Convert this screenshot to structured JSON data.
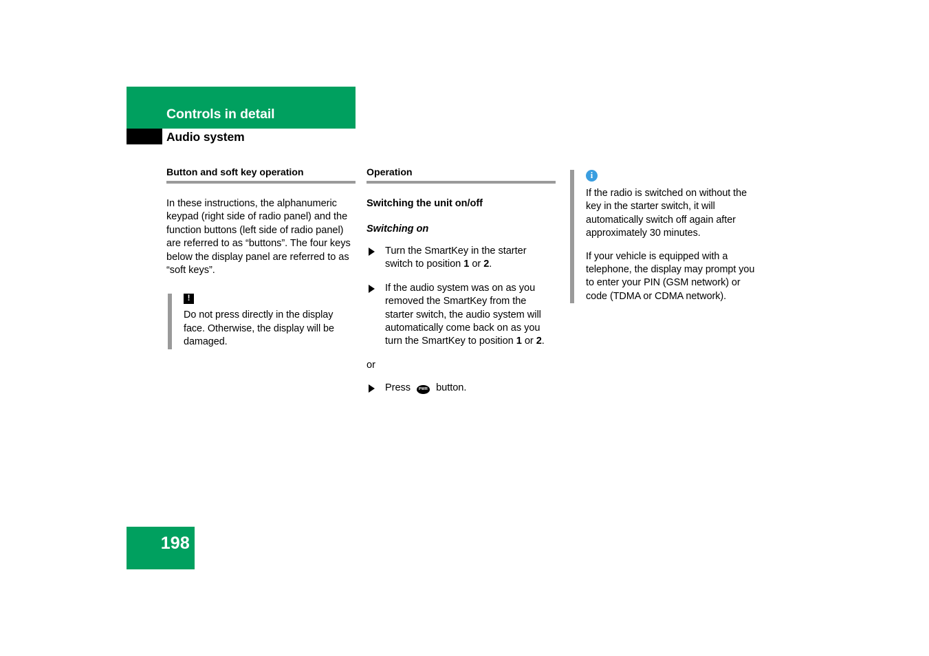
{
  "header": {
    "chapter": "Controls in detail",
    "section": "Audio system",
    "banner_color": "#00A05F"
  },
  "columns": {
    "left": {
      "heading": "Button and soft key operation",
      "paragraph": "In these instructions, the alphanumeric keypad (right side of radio panel) and the function buttons (left side of radio panel) are referred to as “buttons”. The four keys below the display panel are referred to as “soft keys”.",
      "warning": {
        "icon": "warning-exclamation-icon",
        "icon_glyph": "!",
        "text": "Do not press directly in the display face. Otherwise, the display will be damaged."
      }
    },
    "middle": {
      "heading": "Operation",
      "subheading": "Switching the unit on/off",
      "subheading_italic": "Switching on",
      "steps": [
        {
          "marker": "triangle-bullet-icon",
          "text_parts": [
            {
              "t": "Turn the SmartKey in the starter switch to position ",
              "b": false
            },
            {
              "t": "1",
              "b": true
            },
            {
              "t": " or ",
              "b": false
            },
            {
              "t": "2",
              "b": true
            },
            {
              "t": ".",
              "b": false
            }
          ]
        },
        {
          "marker": "triangle-bullet-icon",
          "text_parts": [
            {
              "t": "If the audio system was on as you removed the SmartKey from the starter switch, the audio system will automatically come back on as you turn the SmartKey to position ",
              "b": false
            },
            {
              "t": "1",
              "b": true
            },
            {
              "t": " or ",
              "b": false
            },
            {
              "t": "2",
              "b": true
            },
            {
              "t": ".",
              "b": false
            }
          ]
        }
      ],
      "or_label": "or",
      "press_step": {
        "marker": "triangle-bullet-icon",
        "before": "Press",
        "button_icon_label": "PWR",
        "after": "button."
      }
    },
    "right": {
      "note": {
        "icon": "info-circle-icon",
        "icon_glyph": "i",
        "icon_color": "#3a9ee0",
        "paragraphs": [
          "If the radio is switched on without the key in the starter switch, it will automatically switch off again after approximately 30 minutes.",
          "If your vehicle is equipped with a telephone, the display may prompt you to enter your PIN (GSM network) or code (TDMA or CDMA network)."
        ]
      }
    }
  },
  "footer": {
    "page_number": "198",
    "box_color": "#00A05F"
  }
}
